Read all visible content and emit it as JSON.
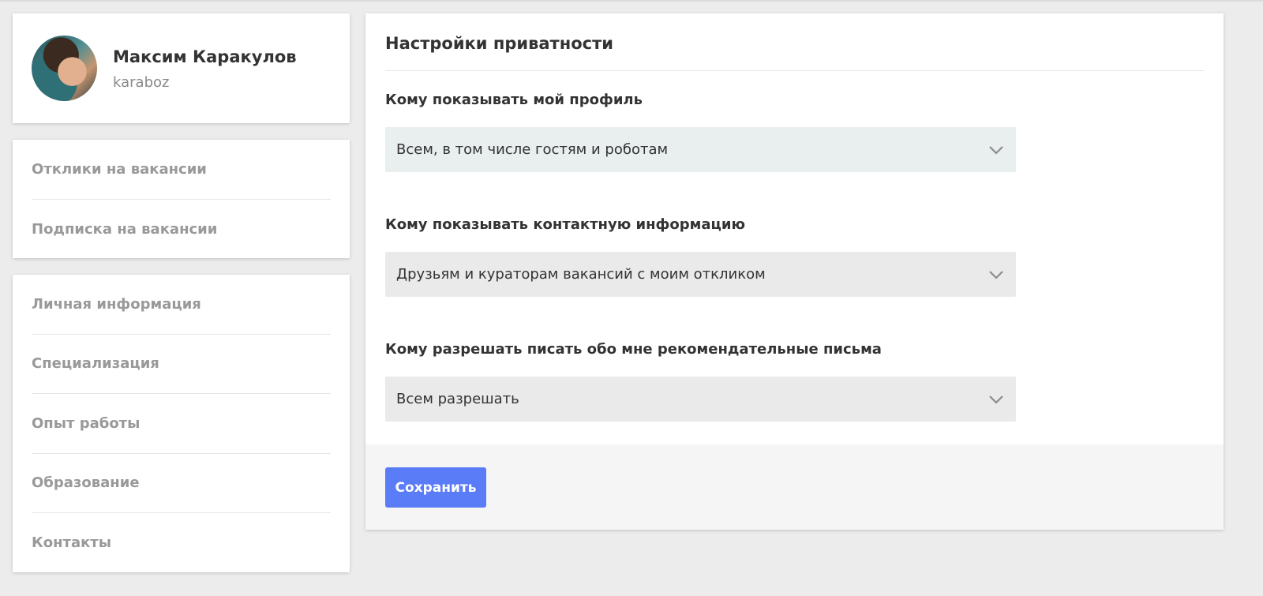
{
  "profile": {
    "name": "Максим Каракулов",
    "login": "karaboz"
  },
  "menu_primary": [
    {
      "label": "Отклики на вакансии"
    },
    {
      "label": "Подписка на вакансии"
    }
  ],
  "menu_secondary": [
    {
      "label": "Личная информация"
    },
    {
      "label": "Специализация"
    },
    {
      "label": "Опыт работы"
    },
    {
      "label": "Образование"
    },
    {
      "label": "Контакты"
    }
  ],
  "privacy": {
    "title": "Настройки приватности",
    "fields": [
      {
        "label": "Кому показывать мой профиль",
        "value": "Всем, в том числе гостям и роботам"
      },
      {
        "label": "Кому показывать контактную информацию",
        "value": "Друзьям и кураторам вакансий с моим откликом"
      },
      {
        "label": "Кому разрешать писать обо мне рекомендательные письма",
        "value": "Всем разрешать"
      }
    ],
    "save_label": "Сохранить"
  },
  "colors": {
    "accent": "#5b7cf7",
    "background": "#ececec",
    "select_bg": "#eaeaea"
  }
}
